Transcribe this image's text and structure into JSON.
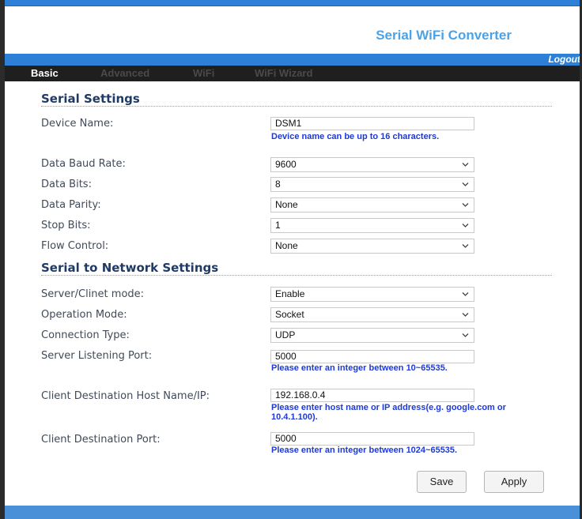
{
  "header": {
    "title": "Serial WiFi Converter",
    "logout_label": "Logout"
  },
  "nav": {
    "tabs": [
      {
        "label": "Basic",
        "active": true
      },
      {
        "label": "Advanced",
        "active": false
      },
      {
        "label": "WiFi",
        "active": false
      },
      {
        "label": "WiFi Wizard",
        "active": false
      }
    ]
  },
  "serial_settings": {
    "title": "Serial Settings",
    "device_name": {
      "label": "Device Name:",
      "value": "DSM1",
      "hint": "Device name can be up to 16 characters."
    },
    "baud_rate": {
      "label": "Data Baud Rate:",
      "value": "9600"
    },
    "data_bits": {
      "label": "Data Bits:",
      "value": "8"
    },
    "parity": {
      "label": "Data Parity:",
      "value": "None"
    },
    "stop_bits": {
      "label": "Stop Bits:",
      "value": "1"
    },
    "flow_control": {
      "label": "Flow Control:",
      "value": "None"
    }
  },
  "network_settings": {
    "title": "Serial to Network Settings",
    "server_client_mode": {
      "label": "Server/Clinet mode:",
      "value": "Enable"
    },
    "operation_mode": {
      "label": "Operation Mode:",
      "value": "Socket"
    },
    "connection_type": {
      "label": "Connection Type:",
      "value": "UDP"
    },
    "listening_port": {
      "label": "Server Listening Port:",
      "value": "5000",
      "hint": "Please enter an integer between 10~65535."
    },
    "dest_host": {
      "label": "Client Destination Host Name/IP:",
      "value": "192.168.0.4",
      "hint_line1": "Please enter host name or IP address(e.g. google.com or",
      "hint_line2": "10.4.1.100)."
    },
    "dest_port": {
      "label": "Client Destination Port:",
      "value": "5000",
      "hint": "Please enter an integer between 1024~65535."
    }
  },
  "buttons": {
    "save_label": "Save",
    "apply_label": "Apply"
  },
  "colors": {
    "accent_blue": "#2e7fd6",
    "title_blue": "#4aa3e8",
    "hint_blue": "#1d39d6",
    "section_navy": "#1f3a64"
  },
  "icons": {
    "dropdown": "chevron-down-icon"
  }
}
